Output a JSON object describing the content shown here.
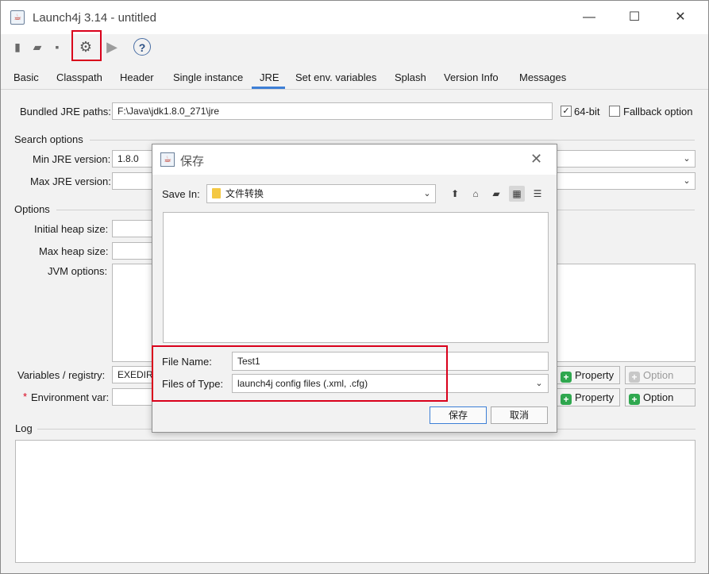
{
  "window": {
    "title": "Launch4j 3.14 - untitled",
    "minimize": "—",
    "maximize": "☐",
    "close": "✕"
  },
  "toolbar": {
    "items": [
      {
        "name": "new-icon",
        "glyph": "▮"
      },
      {
        "name": "open-icon",
        "glyph": "▰"
      },
      {
        "name": "save-icon",
        "glyph": "▪"
      },
      {
        "name": "gear-icon",
        "glyph": "⚙"
      },
      {
        "name": "run-icon",
        "glyph": "▶"
      },
      {
        "name": "help-icon",
        "glyph": "?"
      }
    ]
  },
  "tabs": [
    "Basic",
    "Classpath",
    "Header",
    "Single instance",
    "JRE",
    "Set env. variables",
    "Splash",
    "Version Info",
    "Messages"
  ],
  "active_tab": "JRE",
  "jre": {
    "bundled_label": "Bundled JRE paths:",
    "bundled_value": "F:\\Java\\jdk1.8.0_271\\jre",
    "bit64_label": "64-bit",
    "bit64_checked": "✓",
    "fallback_label": "Fallback option",
    "search_options": "Search options",
    "min_label": "Min JRE version:",
    "min_value": "1.8.0",
    "max_label": "Max JRE version:",
    "options": "Options",
    "initial_heap_label": "Initial heap size:",
    "max_heap_label": "Max heap size:",
    "jvm_label": "JVM options:",
    "vars_label": "Variables / registry:",
    "vars_value": "EXEDIR",
    "env_label": "Environment var:",
    "required": "*",
    "property_label": "Property",
    "option_label": "Option",
    "log_label": "Log"
  },
  "dialog": {
    "title": "保存",
    "close": "✕",
    "save_in_label": "Save In:",
    "save_in_value": "文件转换",
    "file_name_label": "File Name:",
    "file_name_value": "Test1",
    "file_type_label": "Files of Type:",
    "file_type_value": "launch4j config files (.xml, .cfg)",
    "save_button": "保存",
    "cancel_button": "取消",
    "nav": [
      {
        "name": "up-folder-icon",
        "glyph": "⬆"
      },
      {
        "name": "home-icon",
        "glyph": "⌂"
      },
      {
        "name": "new-folder-icon",
        "glyph": "▰"
      },
      {
        "name": "list-view-icon",
        "glyph": "▦"
      },
      {
        "name": "details-view-icon",
        "glyph": "☰"
      }
    ]
  }
}
